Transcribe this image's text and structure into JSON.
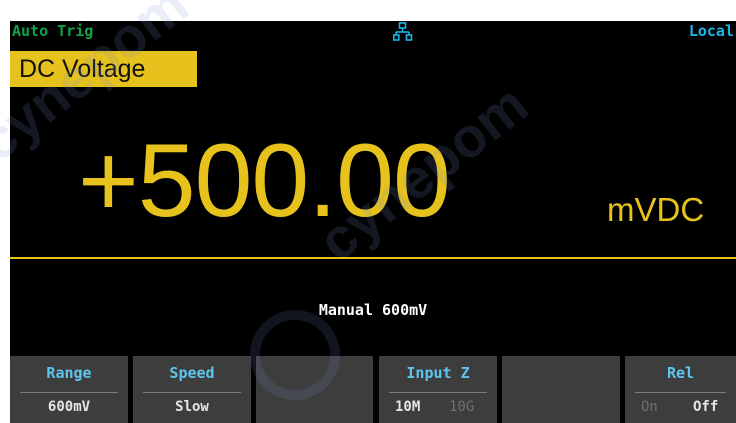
{
  "status_bar": {
    "trigger_mode": "Auto Trig",
    "network_icon": "network-icon",
    "remote_state": "Local"
  },
  "function_label": "DC Voltage",
  "reading": {
    "value": "+500.00",
    "unit": "mVDC"
  },
  "range_status": "Manual 600mV",
  "softkeys": {
    "range": {
      "title": "Range",
      "value": "600mV"
    },
    "speed": {
      "title": "Speed",
      "value": "Slow"
    },
    "input_z": {
      "title": "Input Z",
      "options": [
        "10M",
        "10G"
      ],
      "selected": "10M"
    },
    "rel": {
      "title": "Rel",
      "options": [
        "On",
        "Off"
      ],
      "selected": "Off"
    }
  },
  "watermark": "cynepom",
  "colors": {
    "background": "#000000",
    "accent_yellow": "#e8c21c",
    "trigger_green": "#0fa24a",
    "remote_blue": "#19b6e6",
    "softkey_gray": "#3d3d3d",
    "softkey_title_blue": "#5ec5ef"
  }
}
